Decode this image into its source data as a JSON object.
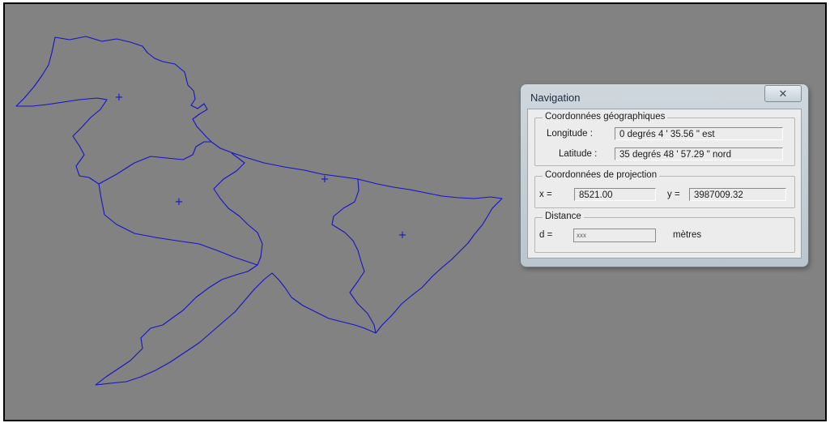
{
  "colors": {
    "map_background": "#828282",
    "boundary": "#1414c8",
    "dialog_frame": "#c3ced6",
    "panel_background": "#ececec"
  },
  "map": {
    "marker_glyph": "+"
  },
  "dialog": {
    "title": "Navigation",
    "close_glyph": "✕",
    "geo_group": {
      "legend": "Coordonnées géographiques",
      "longitude_label": "Longitude :",
      "longitude_value": "0 degrés  4 ' 35.56 \"   est",
      "latitude_label": "Latitude :",
      "latitude_value": "35 degrés 48 ' 57.29 \"   nord"
    },
    "proj_group": {
      "legend": "Coordonnées de projection",
      "x_label": "x =",
      "x_value": "8521.00",
      "y_label": "y =",
      "y_value": "3987009.32"
    },
    "distance_group": {
      "legend": "Distance",
      "d_label": "d =",
      "d_value": "xxx",
      "unit": "mètres"
    }
  }
}
